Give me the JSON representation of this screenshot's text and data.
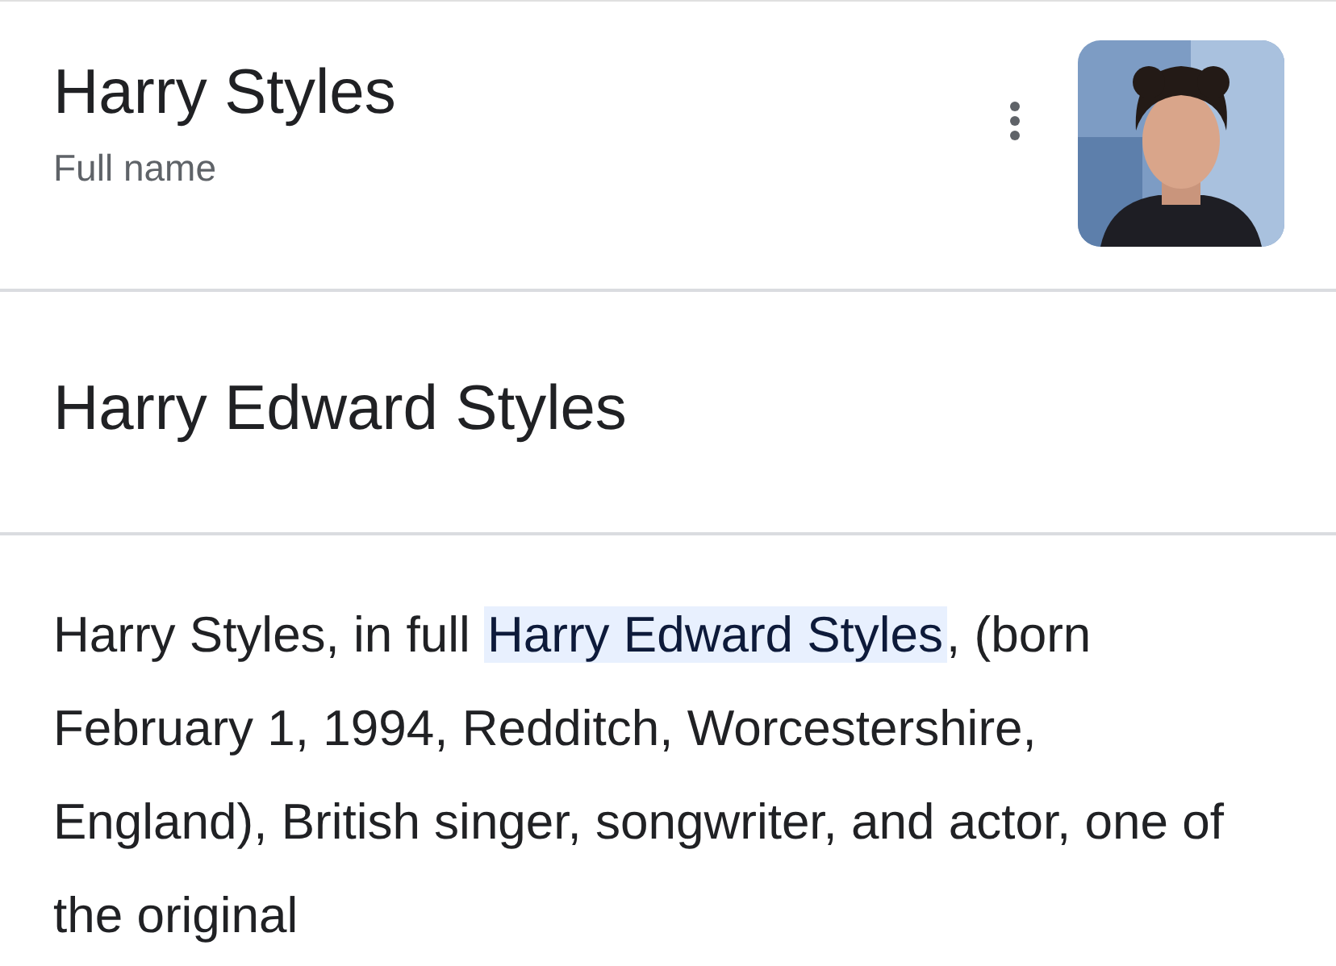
{
  "header": {
    "title": "Harry Styles",
    "subtitle": "Full name"
  },
  "answer": "Harry Edward Styles",
  "description": "Harry Styles, in full **Harry Edward Styles**, (born February 1, 1994, Redditch, Worcestershire, England), British singer, songwriter, and actor, one of the original"
}
